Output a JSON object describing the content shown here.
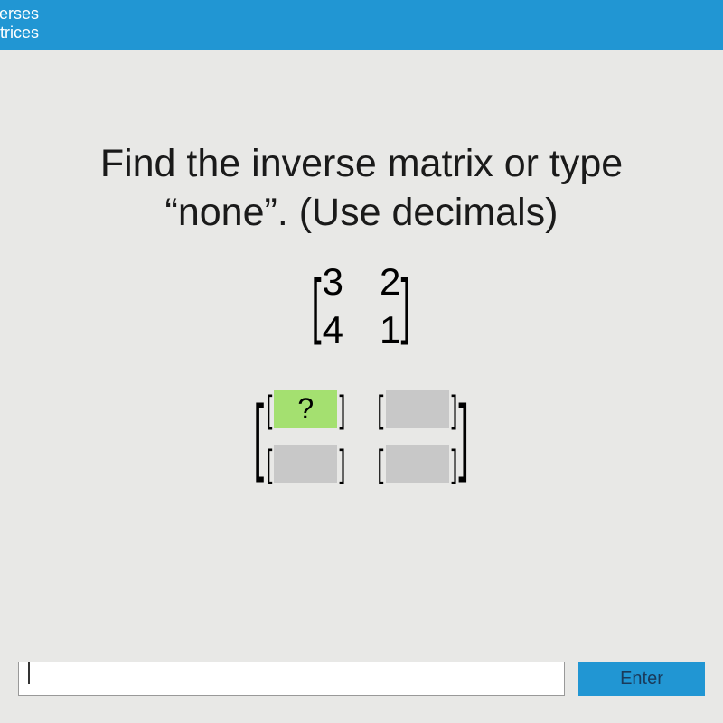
{
  "header": {
    "line1": "verses",
    "line2": "atrices"
  },
  "question": {
    "line1": "Find the inverse matrix or type",
    "line2": "“none”. (Use decimals)"
  },
  "matrix": {
    "r1c1": "3",
    "r1c2": "2",
    "r2c1": "4",
    "r2c2": "1"
  },
  "answer": {
    "active_placeholder": "?",
    "r1c1": "?",
    "r1c2": "",
    "r2c1": "",
    "r2c2": ""
  },
  "input": {
    "value": "",
    "placeholder": ""
  },
  "buttons": {
    "enter": "Enter"
  }
}
